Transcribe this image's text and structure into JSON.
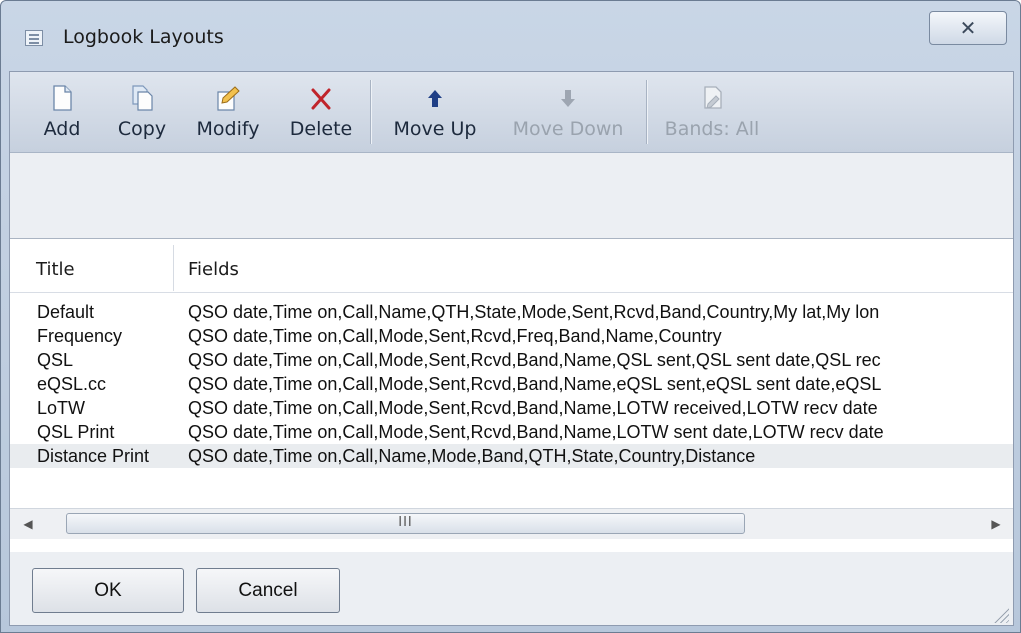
{
  "window": {
    "title": "Logbook Layouts",
    "close_glyph": "✕"
  },
  "toolbar": {
    "add": "Add",
    "copy": "Copy",
    "modify": "Modify",
    "delete": "Delete",
    "move_up": "Move Up",
    "move_down": "Move Down",
    "bands": "Bands: All"
  },
  "list": {
    "columns": [
      "Title",
      "Fields"
    ],
    "rows": [
      {
        "title": "Default",
        "fields": "QSO date,Time on,Call,Name,QTH,State,Mode,Sent,Rcvd,Band,Country,My lat,My lon"
      },
      {
        "title": "Frequency",
        "fields": "QSO date,Time on,Call,Mode,Sent,Rcvd,Freq,Band,Name,Country"
      },
      {
        "title": "QSL",
        "fields": "QSO date,Time on,Call,Mode,Sent,Rcvd,Band,Name,QSL sent,QSL sent date,QSL rec"
      },
      {
        "title": "eQSL.cc",
        "fields": "QSO date,Time on,Call,Mode,Sent,Rcvd,Band,Name,eQSL sent,eQSL sent date,eQSL"
      },
      {
        "title": "LoTW",
        "fields": "QSO date,Time on,Call,Mode,Sent,Rcvd,Band,Name,LOTW received,LOTW recv date"
      },
      {
        "title": "QSL Print",
        "fields": "QSO date,Time on,Call,Mode,Sent,Rcvd,Band,Name,LOTW sent date,LOTW recv date"
      },
      {
        "title": "Distance Print",
        "fields": "QSO date,Time on,Call,Name,Mode,Band,QTH,State,Country,Distance"
      }
    ],
    "scroll_grip": "III"
  },
  "footer": {
    "ok": "OK",
    "cancel": "Cancel"
  }
}
